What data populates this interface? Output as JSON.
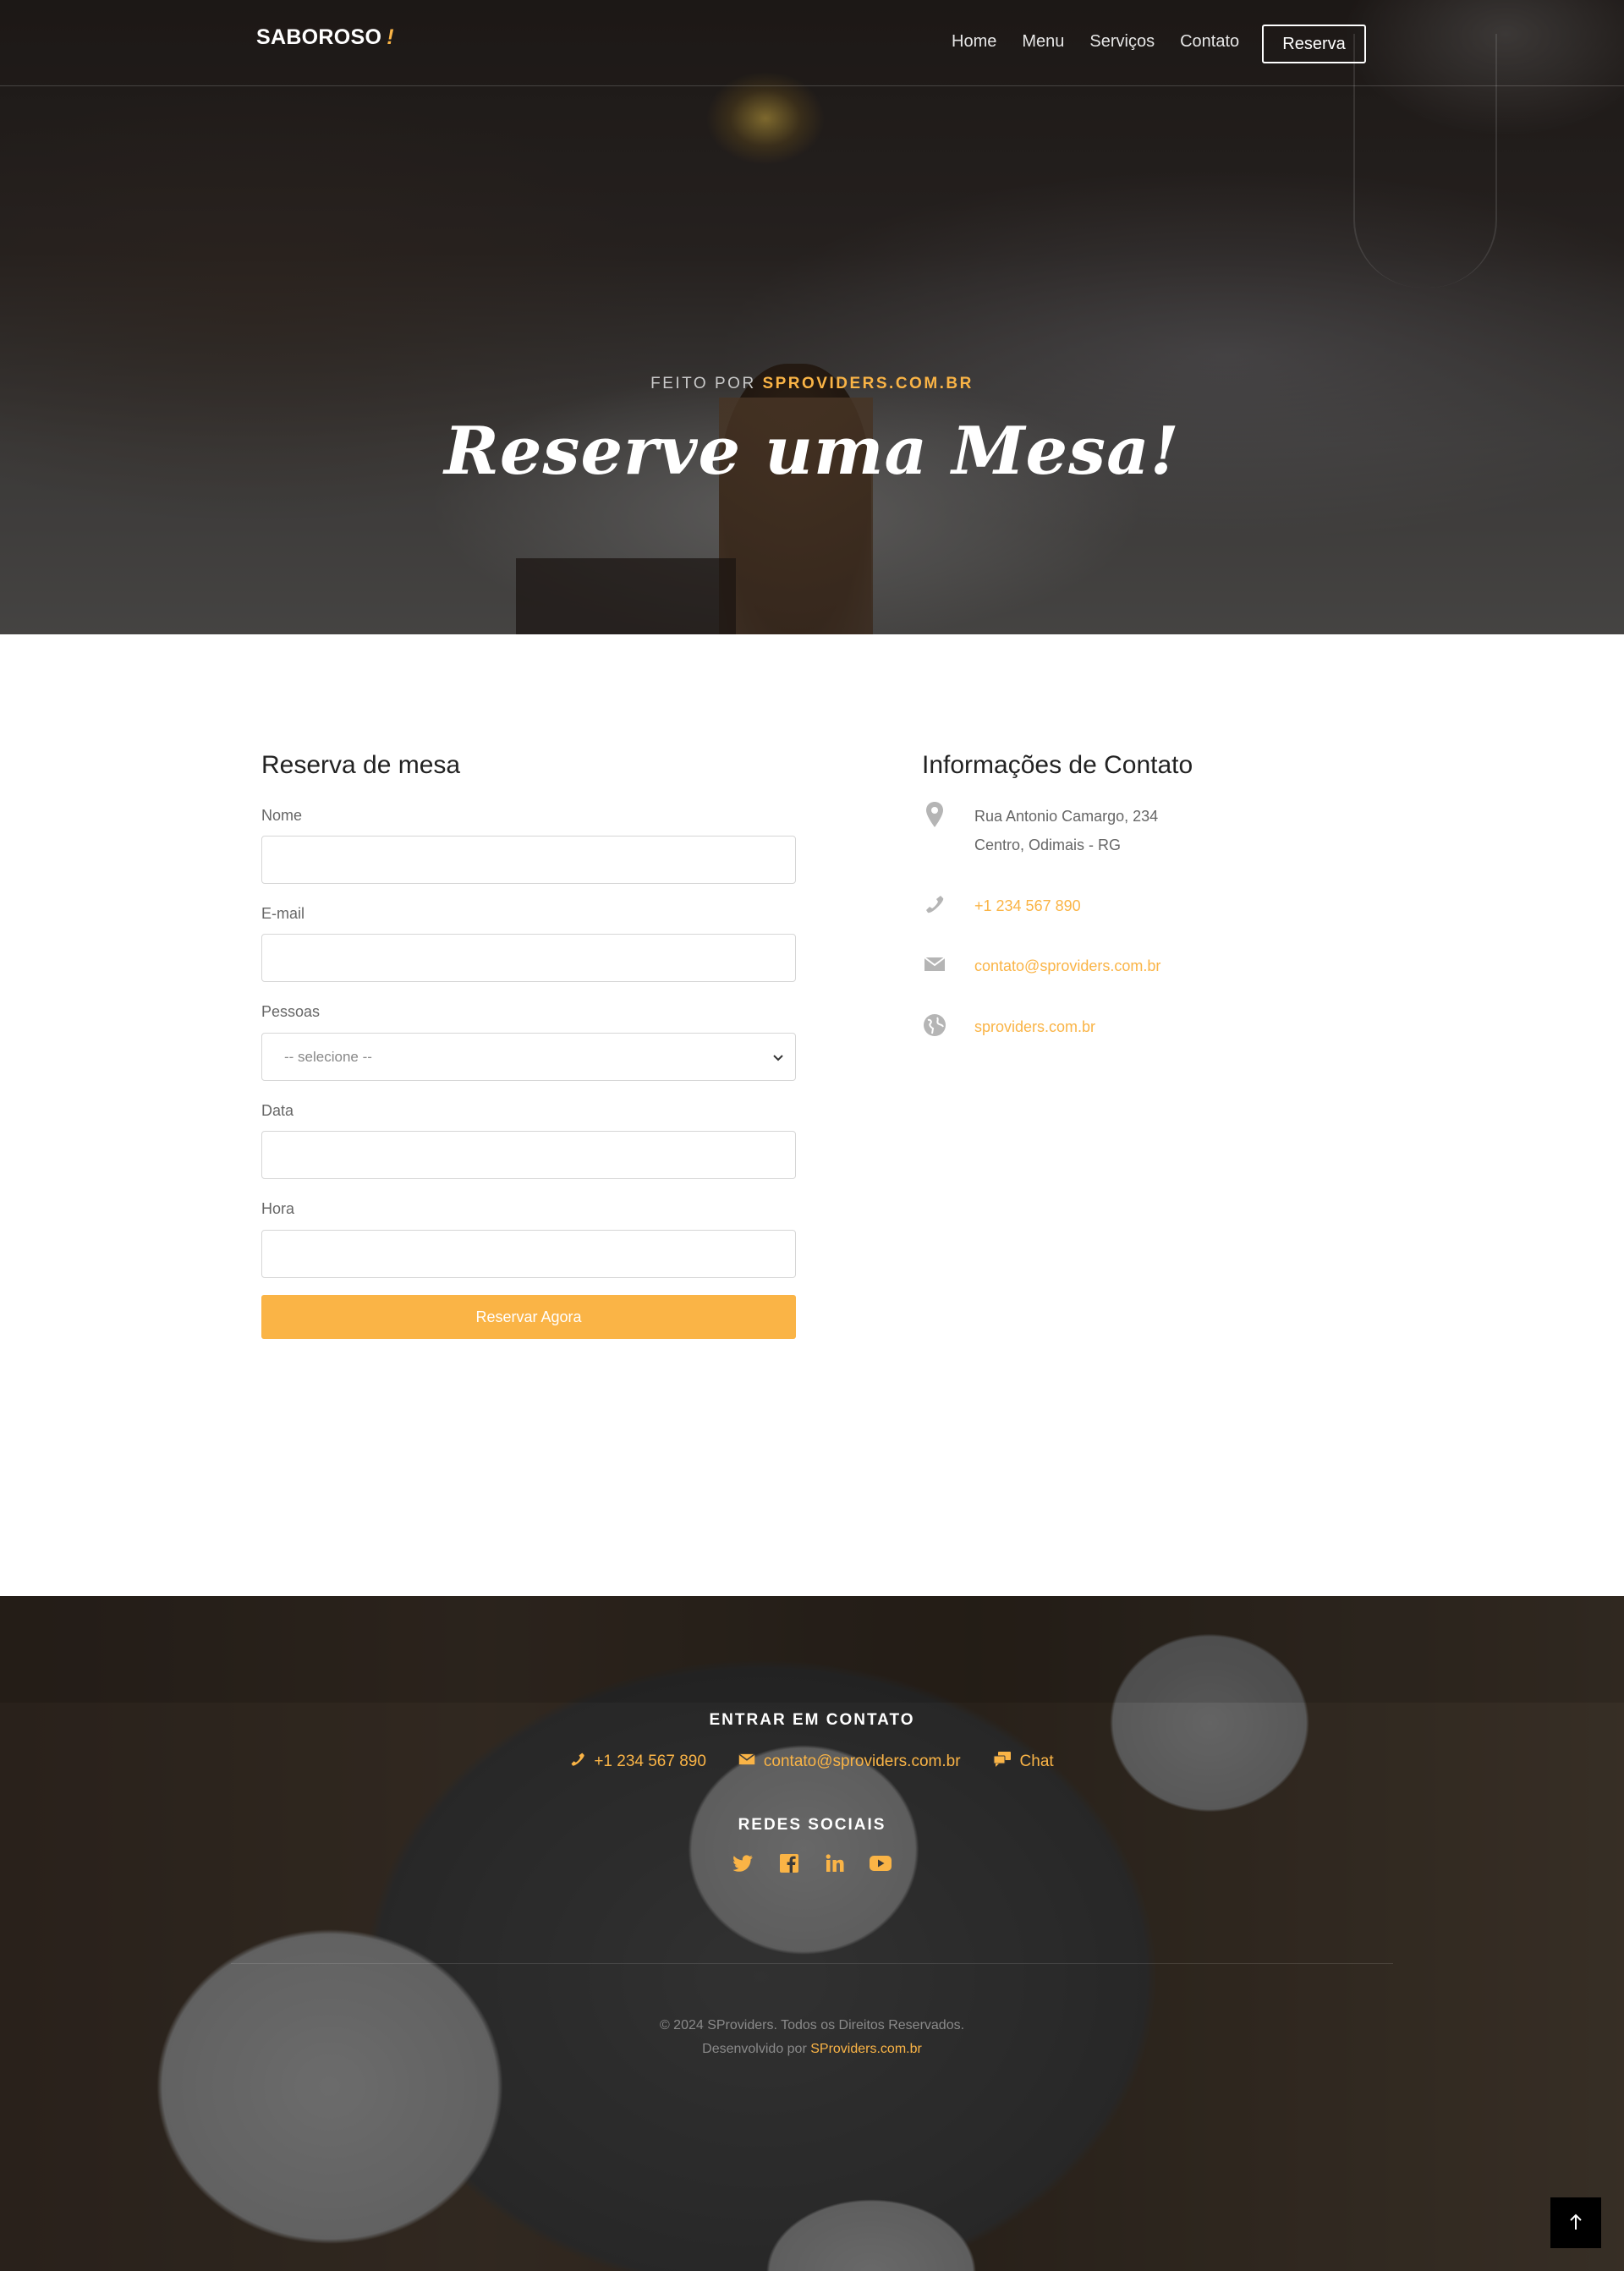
{
  "nav": {
    "logo": "SABOROSO",
    "logo_accent": "!",
    "links": [
      "Home",
      "Menu",
      "Serviços",
      "Contato"
    ],
    "reserve_button": "Reserva"
  },
  "hero": {
    "subtitle_prefix": "FEITO POR",
    "subtitle_brand": "SPROVIDERS.COM.BR",
    "title": "Reserve uma Mesa!"
  },
  "form": {
    "title": "Reserva de mesa",
    "name_label": "Nome",
    "email_label": "E-mail",
    "people_label": "Pessoas",
    "people_selected": "-- selecione --",
    "date_label": "Data",
    "time_label": "Hora",
    "submit_label": "Reservar Agora"
  },
  "contact_info": {
    "title": "Informações de Contato",
    "address_line1": "Rua Antonio Camargo, 234",
    "address_line2": "Centro, Odimais - RG",
    "phone": "+1 234 567 890",
    "email": "contato@sproviders.com.br",
    "website": "sproviders.com.br",
    "icons": [
      "map-pin-icon",
      "phone-icon",
      "envelope-icon",
      "globe-icon"
    ]
  },
  "footer": {
    "contact_heading": "ENTRAR EM CONTATO",
    "phone": "+1 234 567 890",
    "email": "contato@sproviders.com.br",
    "chat": "Chat",
    "social_heading": "REDES SOCIAIS",
    "socials": [
      "twitter-icon",
      "facebook-icon",
      "linkedin-icon",
      "youtube-icon"
    ],
    "copyright": "© 2024 SProviders. Todos os Direitos Reservados.",
    "developed_by_prefix": "Desenvolvido por",
    "developed_by_link": "SProviders.com.br"
  },
  "colors": {
    "accent": "#fab446",
    "dark": "#000000",
    "text": "#444444"
  }
}
